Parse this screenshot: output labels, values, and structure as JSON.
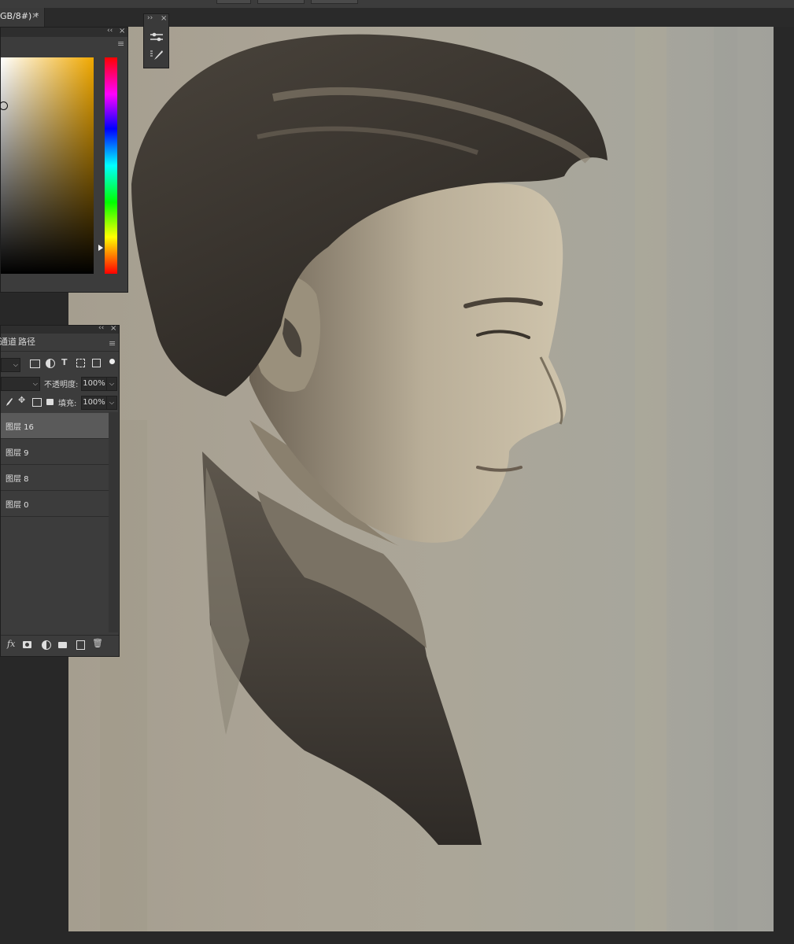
{
  "document": {
    "tab_title": "GB/8#) *",
    "close": "×"
  },
  "tool_strip": {
    "collapse": "››",
    "close": "×",
    "icons": [
      "adjust-sliders-icon",
      "brush-presets-icon"
    ]
  },
  "color_panel": {
    "collapse": "‹‹",
    "close": "×",
    "menu": "≡",
    "hue_colors": [
      "#ff0000",
      "#ff00ff",
      "#0000ff",
      "#00ffff",
      "#00ff00",
      "#ffff00",
      "#ff0000"
    ],
    "base_color": "#f0a800"
  },
  "layers_panel": {
    "collapse": "‹‹",
    "close": "×",
    "menu": "≡",
    "tabs": [
      "通道",
      "路径"
    ],
    "opacity_label": "不透明度:",
    "opacity_value": "100%",
    "fill_label": "填充:",
    "fill_value": "100%",
    "layers": [
      {
        "name": "图层 16",
        "selected": true
      },
      {
        "name": "图层 9",
        "selected": false
      },
      {
        "name": "图层 8",
        "selected": false
      },
      {
        "name": "图层 0",
        "selected": false
      }
    ],
    "footer_icons": [
      "fx-icon",
      "mask-icon",
      "adjustment-icon",
      "folder-icon",
      "new-layer-icon",
      "trash-icon"
    ],
    "fx_label": "fx"
  },
  "colors": {
    "canvas": "#a8a396",
    "panel": "#3c3c3c",
    "selected_layer": "#5a5a5a"
  }
}
